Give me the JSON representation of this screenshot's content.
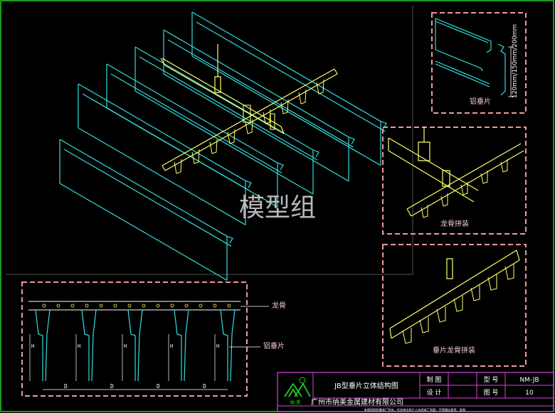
{
  "watermark": "模型组",
  "details": {
    "blade_label": "铝垂片",
    "blade_heights": "120mm/150mm/200mm",
    "assembly_label": "龙骨拼装",
    "carrier_label": "垂片龙骨拼装"
  },
  "section": {
    "keel_label": "龙骨",
    "blade_label": "铝垂片",
    "height_mark": "H",
    "spacing_mark": "D"
  },
  "title_block": {
    "title": "JB型垂片立体结构图",
    "company": "广州市纳美金属建材有限公司",
    "drawn_label": "制  图",
    "design_label": "设  计",
    "model_label": "型  号",
    "model_value": "NM-JB",
    "drawing_no_label": "图  号",
    "drawing_no_value": "10",
    "logo_text": "纳  美",
    "note": "本图纸版权属本厂所有，任何单位和个人未经本厂同意，不得擅自使用、复制"
  },
  "colors": {
    "cyan": "#33dddd",
    "yellow": "#ffff66",
    "pink_frame": "#e89a9a",
    "green_border": "#22cc22",
    "magenta": "#dd44dd"
  }
}
